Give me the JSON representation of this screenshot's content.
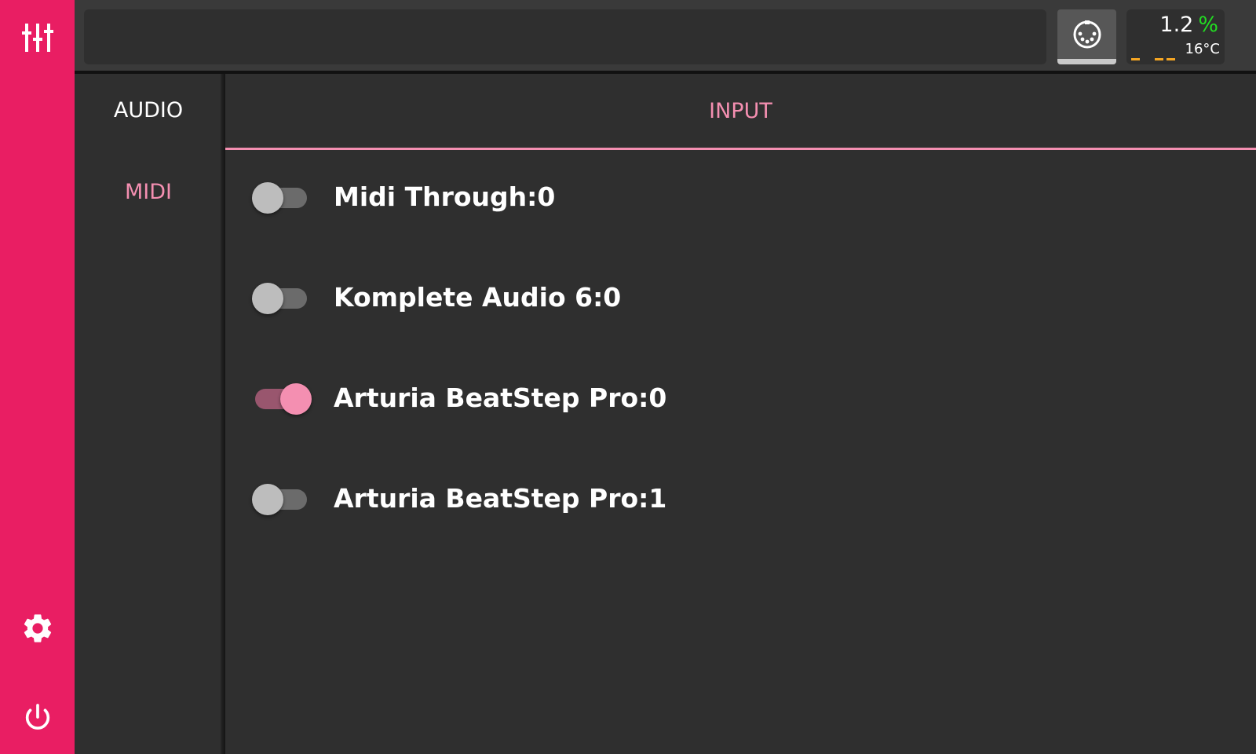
{
  "rail": {
    "top_icon": "mixer-sliders-icon",
    "bottom_icons": [
      "gear-icon",
      "power-icon"
    ],
    "color": "#e91e63"
  },
  "topbar": {
    "status_text": "",
    "midi_icon": "midi-din-connector-icon",
    "cpu": {
      "value": "1.2",
      "unit": "%"
    },
    "temperature": "16°C"
  },
  "subnav": {
    "items": [
      {
        "label": "AUDIO",
        "active": false
      },
      {
        "label": "MIDI",
        "active": true
      }
    ]
  },
  "content": {
    "tab": "INPUT",
    "ports": [
      {
        "label": "Midi Through:0",
        "enabled": false
      },
      {
        "label": "Komplete Audio 6:0",
        "enabled": false
      },
      {
        "label": "Arturia BeatStep Pro:0",
        "enabled": true
      },
      {
        "label": "Arturia BeatStep Pro:1",
        "enabled": false
      }
    ]
  },
  "colors": {
    "accent": "#f48fb1",
    "brand": "#e91e63",
    "background": "#2f2f2f",
    "cpu_unit": "#22dd22",
    "meter": "#f5a623"
  }
}
